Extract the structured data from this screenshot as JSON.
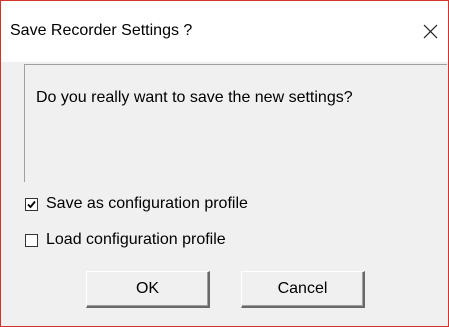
{
  "window": {
    "title": "Save Recorder Settings ?",
    "border_color": "#d4322c",
    "close_icon": "close-icon"
  },
  "message": {
    "text": "Do you really want to save the new settings?"
  },
  "options": [
    {
      "label": "Save as configuration profile",
      "checked": true
    },
    {
      "label": "Load configuration profile",
      "checked": false
    }
  ],
  "buttons": {
    "ok_label": "OK",
    "cancel_label": "Cancel"
  }
}
